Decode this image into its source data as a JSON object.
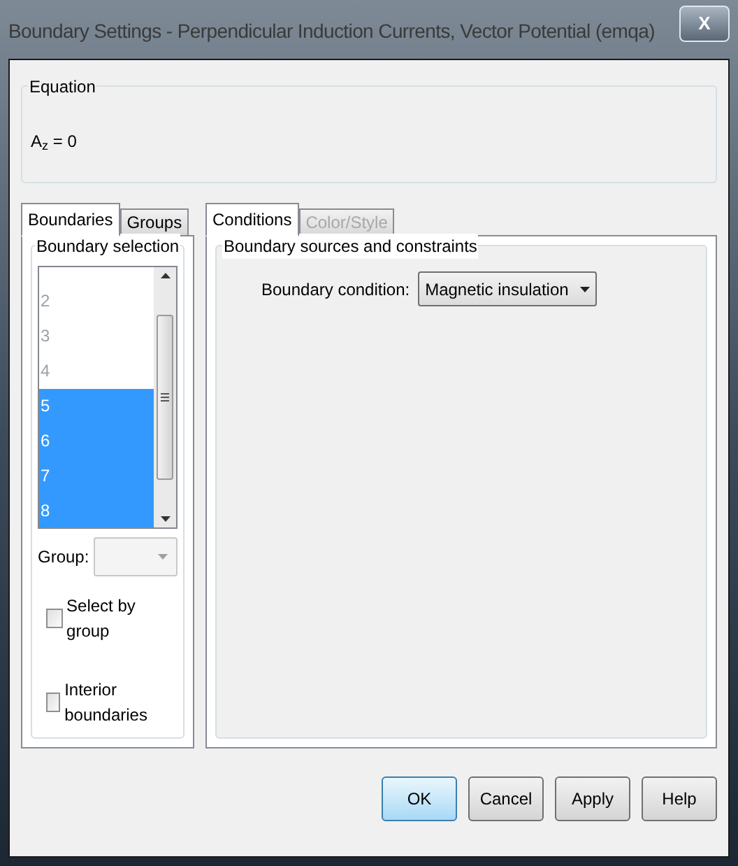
{
  "window": {
    "title": "Boundary Settings - Perpendicular Induction Currents, Vector Potential (emqa)",
    "close": "X"
  },
  "equation": {
    "label": "Equation",
    "text": "A$_{z}$ = 0"
  },
  "left_tabs": [
    {
      "label": "Boundaries",
      "selected": true
    },
    {
      "label": "Groups",
      "selected": false
    }
  ],
  "boundary_selection": {
    "label": "Boundary selection",
    "items": [
      {
        "label": "2",
        "selected": false
      },
      {
        "label": "3",
        "selected": false
      },
      {
        "label": "4",
        "selected": false
      },
      {
        "label": "5",
        "selected": true
      },
      {
        "label": "6",
        "selected": true
      },
      {
        "label": "7",
        "selected": true
      },
      {
        "label": "8",
        "selected": true
      }
    ]
  },
  "group": {
    "label": "Group:",
    "disabled": true
  },
  "checkboxes": [
    {
      "label": "Select by group",
      "checked": false
    },
    {
      "label": "Interior boundaries",
      "checked": false
    }
  ],
  "right_tabs": [
    {
      "label": "Conditions",
      "selected": true,
      "disabled": false
    },
    {
      "label": "Color/Style",
      "selected": false,
      "disabled": true
    }
  ],
  "conditions": {
    "group_label": "Boundary sources and constraints",
    "field_label": "Boundary condition:",
    "value": "Magnetic insulation"
  },
  "buttons": [
    {
      "label": "OK",
      "default": true
    },
    {
      "label": "Cancel",
      "default": false
    },
    {
      "label": "Apply",
      "default": false
    },
    {
      "label": "Help",
      "default": false
    }
  ]
}
